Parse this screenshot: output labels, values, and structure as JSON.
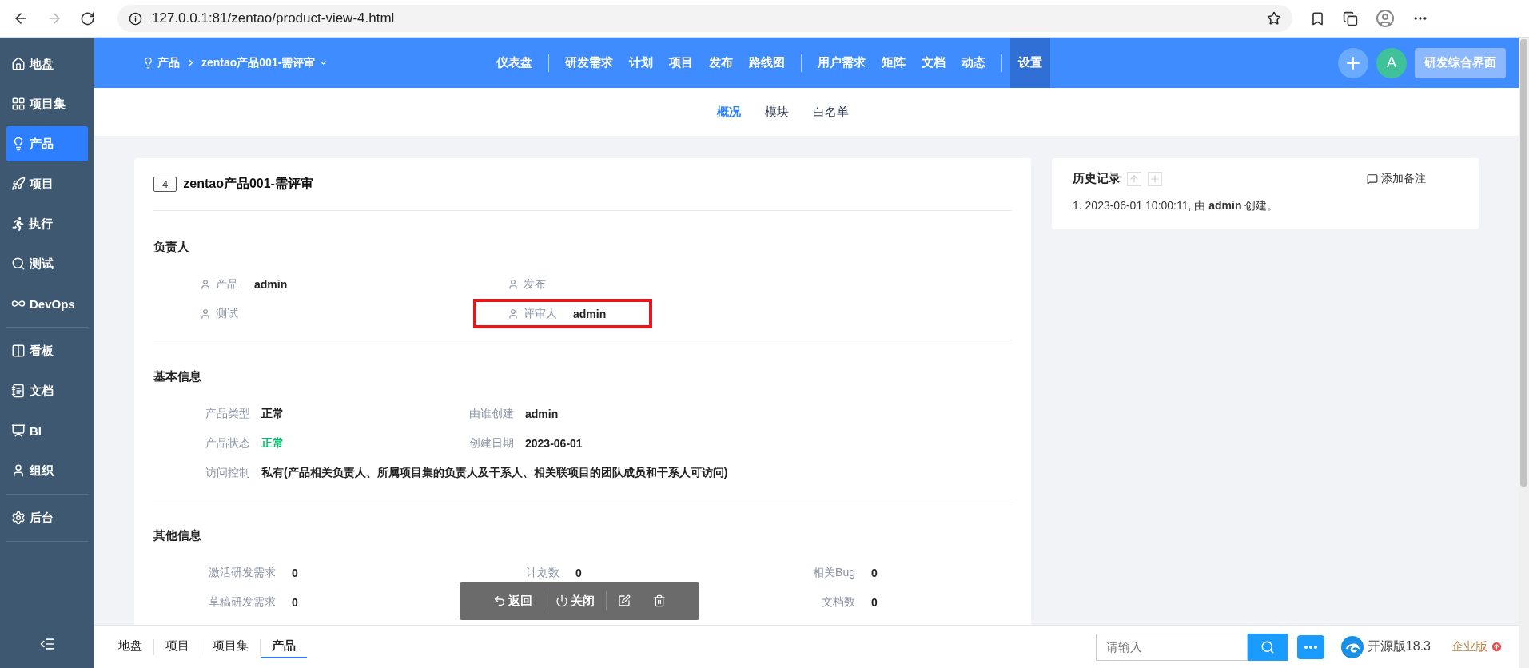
{
  "browser": {
    "url": "127.0.0.1:81/zentao/product-view-4.html"
  },
  "sidebar": {
    "groups": [
      [
        {
          "label": "地盘",
          "selected": false
        },
        {
          "label": "项目集",
          "selected": false
        },
        {
          "label": "产品",
          "selected": true
        },
        {
          "label": "项目",
          "selected": false
        },
        {
          "label": "执行",
          "selected": false
        },
        {
          "label": "测试",
          "selected": false
        },
        {
          "label": "DevOps",
          "selected": false
        }
      ],
      [
        {
          "label": "看板",
          "selected": false
        },
        {
          "label": "文档",
          "selected": false
        },
        {
          "label": "BI",
          "selected": false
        },
        {
          "label": "组织",
          "selected": false
        }
      ],
      [
        {
          "label": "后台",
          "selected": false
        }
      ]
    ]
  },
  "header": {
    "section": "产品",
    "product": "zentao产品001-需评审",
    "nav_groups": [
      [
        {
          "label": "仪表盘",
          "selected": false
        }
      ],
      [
        {
          "label": "研发需求",
          "selected": false
        },
        {
          "label": "计划",
          "selected": false
        },
        {
          "label": "项目",
          "selected": false
        },
        {
          "label": "发布",
          "selected": false
        },
        {
          "label": "路线图",
          "selected": false
        }
      ],
      [
        {
          "label": "用户需求",
          "selected": false
        },
        {
          "label": "矩阵",
          "selected": false
        },
        {
          "label": "文档",
          "selected": false
        },
        {
          "label": "动态",
          "selected": false
        }
      ],
      [
        {
          "label": "设置",
          "selected": true
        }
      ]
    ],
    "avatar": "A",
    "mode_button": "研发综合界面"
  },
  "subnav": [
    {
      "label": "概况",
      "selected": true
    },
    {
      "label": "模块",
      "selected": false
    },
    {
      "label": "白名单",
      "selected": false
    }
  ],
  "product": {
    "id": "4",
    "name": "zentao产品001-需评审"
  },
  "owners": {
    "title": "负责人",
    "items": [
      {
        "label": "产品",
        "value": "admin",
        "highlighted": false
      },
      {
        "label": "发布",
        "highlighted": false
      },
      {
        "label": "测试",
        "highlighted": false
      },
      {
        "label": "评审人",
        "value": "admin",
        "highlighted": true
      }
    ]
  },
  "basic": {
    "title": "基本信息",
    "items": [
      {
        "label": "产品类型",
        "value": "正常"
      },
      {
        "label": "由谁创建",
        "value": "admin"
      },
      {
        "label": "产品状态",
        "value": "正常",
        "color": "#00c26e"
      },
      {
        "label": "创建日期",
        "value": "2023-06-01"
      },
      {
        "label": "访问控制",
        "value": "私有(产品相关负责人、所属项目集的负责人及干系人、相关联项目的团队成员和干系人可访问)"
      }
    ]
  },
  "other": {
    "title": "其他信息",
    "columns": [
      [
        {
          "label": "激活研发需求",
          "value": "0"
        },
        {
          "label": "草稿研发需求",
          "value": "0"
        }
      ],
      [
        {
          "label": "计划数",
          "value": "0"
        }
      ],
      [
        {
          "label": "相关Bug",
          "value": "0"
        },
        {
          "label": "文档数",
          "value": "0"
        }
      ]
    ]
  },
  "history": {
    "title": "历史记录",
    "add_note": "添加备注",
    "entries": [
      "1. 2023-06-01 10:00:11, 由 **admin** 创建。"
    ]
  },
  "toolbar": [
    {
      "kind": "back",
      "label": "返回"
    },
    {
      "kind": "close",
      "label": "关闭"
    },
    {
      "kind": "edit"
    },
    {
      "kind": "delete"
    }
  ],
  "footer": {
    "crumbs": [
      {
        "label": "地盘",
        "selected": false
      },
      {
        "label": "项目",
        "selected": false
      },
      {
        "label": "项目集",
        "selected": false
      },
      {
        "label": "产品",
        "selected": true
      }
    ],
    "search": {
      "placeholder": "请输入"
    },
    "version": "开源版18.3",
    "enterprise": "企业版"
  }
}
